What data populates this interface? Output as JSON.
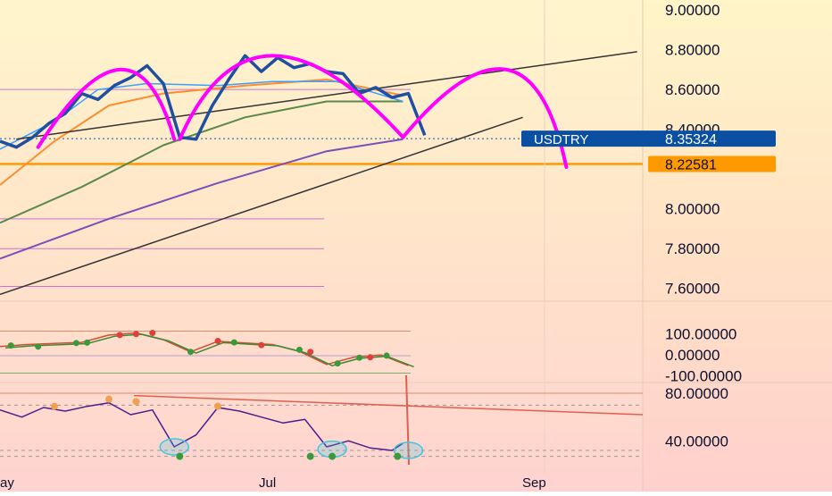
{
  "colors": {
    "price": "#1e4fa0",
    "arc": "#ff00ff",
    "trendline": "#333333",
    "ma_fast": "#3aa0ff",
    "ma_orange": "#ff8c2e",
    "ma_green": "#5a8a4a",
    "ma_purple": "#7a4fb8",
    "badge_blue": "#0b4fa3",
    "badge_orange": "#ff9900",
    "label_text": "#0a0f2e",
    "rsi_line": "#4a1e8c",
    "circle": "#43c5e0",
    "dot_red": "#e0403a",
    "dot_green": "#3a9a3a",
    "dot_orange": "#f0a050"
  },
  "main_axis": {
    "labels": [
      "9.00000",
      "8.80000",
      "8.60000",
      "8.40000",
      "8.00000",
      "7.80000",
      "7.60000"
    ]
  },
  "badges": {
    "symbol": {
      "name": "USDTRY",
      "value": "8.35324"
    },
    "level": {
      "value": "8.22581"
    }
  },
  "osc_axis": {
    "labels": [
      "100.00000",
      "0.00000",
      "-100.00000"
    ]
  },
  "rsi_axis": {
    "labels": [
      "80.00000",
      "40.00000"
    ]
  },
  "time_axis": {
    "labels": [
      "ay",
      "Jul",
      "Sep"
    ]
  },
  "chart_data": [
    {
      "type": "line",
      "name": "price",
      "ylim": [
        7.5,
        9.05
      ],
      "x": [
        0,
        3,
        6,
        9,
        12,
        15,
        18,
        21,
        24,
        27,
        30,
        33,
        36,
        39,
        42,
        45,
        48,
        51,
        54,
        57,
        60,
        63,
        66,
        69,
        72,
        75,
        78
      ],
      "values": [
        8.34,
        8.31,
        8.36,
        8.43,
        8.48,
        8.58,
        8.55,
        8.62,
        8.66,
        8.72,
        8.63,
        8.36,
        8.35,
        8.52,
        8.65,
        8.77,
        8.69,
        8.76,
        8.71,
        8.73,
        8.69,
        8.68,
        8.58,
        8.61,
        8.56,
        8.58,
        8.37
      ],
      "overlays": {
        "ma_fast": [
          [
            0,
            8.3
          ],
          [
            10,
            8.44
          ],
          [
            18,
            8.6
          ],
          [
            27,
            8.63
          ],
          [
            40,
            8.62
          ],
          [
            50,
            8.64
          ],
          [
            62,
            8.64
          ],
          [
            74,
            8.54
          ]
        ],
        "ma_orange": [
          [
            0,
            8.12
          ],
          [
            10,
            8.34
          ],
          [
            20,
            8.52
          ],
          [
            30,
            8.58
          ],
          [
            45,
            8.62
          ],
          [
            60,
            8.65
          ],
          [
            74,
            8.57
          ]
        ],
        "ma_green": [
          [
            0,
            7.93
          ],
          [
            15,
            8.11
          ],
          [
            30,
            8.32
          ],
          [
            45,
            8.46
          ],
          [
            60,
            8.54
          ],
          [
            74,
            8.54
          ]
        ],
        "ma_purple": [
          [
            0,
            7.75
          ],
          [
            20,
            7.95
          ],
          [
            40,
            8.13
          ],
          [
            60,
            8.29
          ],
          [
            74,
            8.35
          ]
        ],
        "trend_lower": [
          [
            0,
            7.57
          ],
          [
            96,
            8.46
          ]
        ],
        "trend_upper": [
          [
            3,
            8.35
          ],
          [
            117,
            8.79
          ]
        ],
        "projection_arcs": [
          [
            [
              7,
              8.31
            ],
            [
              22,
              8.7
            ],
            [
              32,
              8.35
            ]
          ],
          [
            [
              33,
              8.35
            ],
            [
              50,
              8.77
            ],
            [
              74,
              8.36
            ]
          ],
          [
            [
              74,
              8.36
            ],
            [
              93,
              8.7
            ],
            [
              104,
              8.21
            ]
          ]
        ]
      }
    },
    {
      "type": "line",
      "name": "oscillator",
      "ylim": [
        -110,
        110
      ],
      "x": [
        0,
        5,
        10,
        15,
        20,
        25,
        30,
        35,
        40,
        45,
        50,
        55,
        60,
        65,
        70,
        75
      ],
      "values": [
        5,
        15,
        20,
        25,
        60,
        70,
        38,
        -20,
        30,
        22,
        15,
        -18,
        -80,
        -45,
        -35,
        -85
      ],
      "markers": [
        [
          2,
          10,
          "green"
        ],
        [
          7,
          5,
          "green"
        ],
        [
          14,
          22,
          "green"
        ],
        [
          16,
          24,
          "green"
        ],
        [
          22,
          60,
          "red"
        ],
        [
          25,
          65,
          "red"
        ],
        [
          28,
          70,
          "red"
        ],
        [
          35,
          -20,
          "green"
        ],
        [
          40,
          32,
          "red"
        ],
        [
          43,
          25,
          "green"
        ],
        [
          48,
          12,
          "red"
        ],
        [
          55,
          -10,
          "green"
        ],
        [
          57,
          -20,
          "red"
        ],
        [
          62,
          -75,
          "green"
        ],
        [
          66,
          -48,
          "green"
        ],
        [
          68,
          -46,
          "red"
        ],
        [
          71,
          -38,
          "green"
        ]
      ]
    },
    {
      "type": "line",
      "name": "rsi",
      "ylim": [
        20,
        95
      ],
      "x": [
        0,
        4,
        8,
        12,
        16,
        20,
        24,
        28,
        32,
        36,
        40,
        44,
        48,
        52,
        56,
        60,
        64,
        68,
        72,
        74
      ],
      "values": [
        66,
        60,
        68,
        65,
        69,
        72,
        62,
        66,
        35,
        45,
        68,
        65,
        60,
        55,
        58,
        35,
        40,
        34,
        32,
        38
      ]
    }
  ]
}
